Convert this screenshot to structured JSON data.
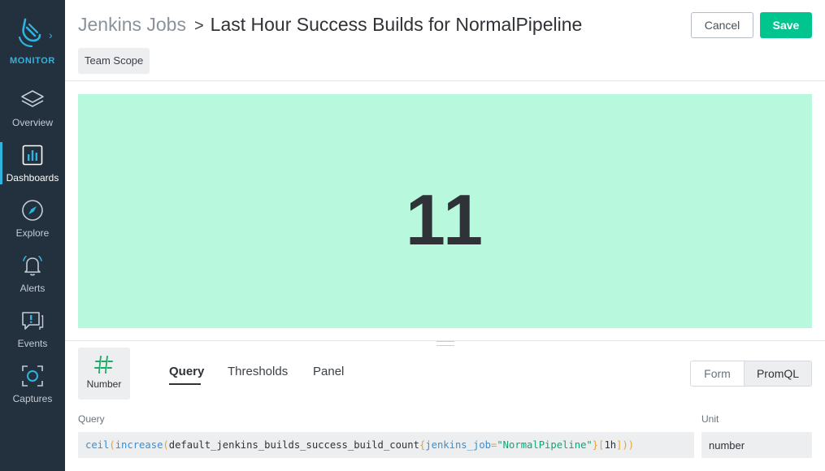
{
  "sidebar": {
    "brand_label": "MONITOR",
    "items": [
      {
        "label": "Overview",
        "icon": "layers-icon"
      },
      {
        "label": "Dashboards",
        "icon": "bar-chart-icon",
        "active": true
      },
      {
        "label": "Explore",
        "icon": "compass-icon"
      },
      {
        "label": "Alerts",
        "icon": "bell-icon"
      },
      {
        "label": "Events",
        "icon": "chat-alert-icon"
      },
      {
        "label": "Captures",
        "icon": "capture-icon"
      }
    ]
  },
  "header": {
    "breadcrumb_parent": "Jenkins Jobs",
    "breadcrumb_separator": ">",
    "title": "Last Hour Success Builds for NormalPipeline",
    "scope_chip": "Team Scope",
    "cancel_label": "Cancel",
    "save_label": "Save"
  },
  "panel": {
    "value": "11",
    "background_color": "#b8f9de"
  },
  "editor": {
    "viz_type_label": "Number",
    "tabs": [
      {
        "label": "Query",
        "active": true
      },
      {
        "label": "Thresholds"
      },
      {
        "label": "Panel"
      }
    ],
    "mode_form": "Form",
    "mode_promql": "PromQL",
    "query_label": "Query",
    "query": {
      "fn1": "ceil",
      "fn2": "increase",
      "metric": "default_jenkins_builds_success_build_count",
      "label_key": "jenkins_job",
      "label_value": "\"NormalPipeline\"",
      "range": "1h"
    },
    "unit_label": "Unit",
    "unit_value": "number"
  },
  "colors": {
    "sidebar_bg": "#23303d",
    "accent_blue": "#2fb4e0",
    "save_green": "#00c58e"
  }
}
